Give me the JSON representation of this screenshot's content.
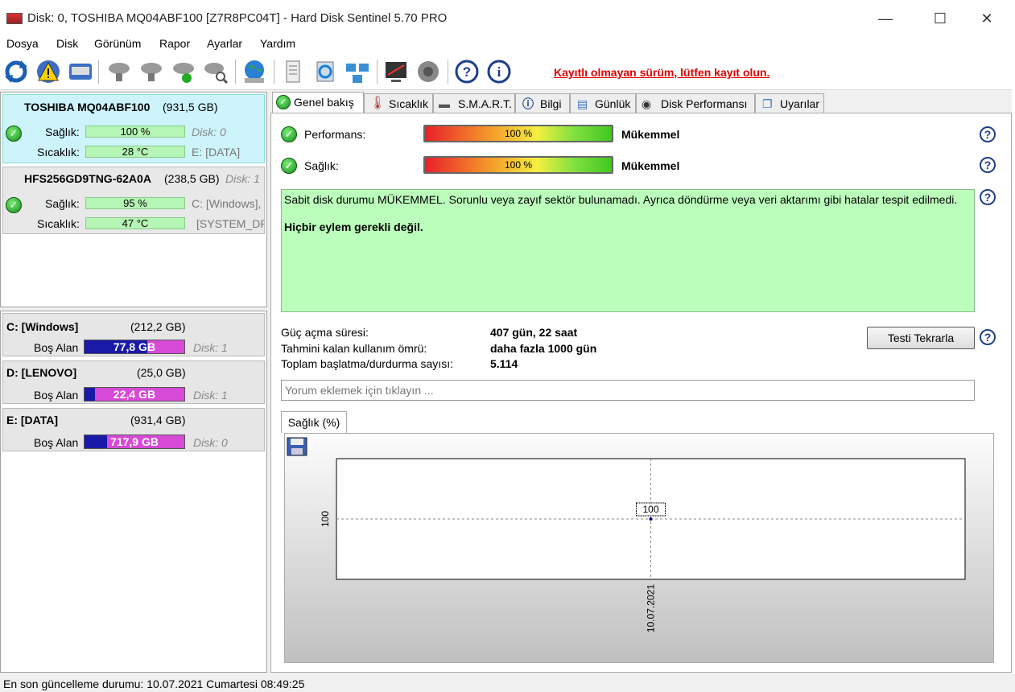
{
  "window": {
    "title": "Disk: 0, TOSHIBA MQ04ABF100 [Z7R8PC04T]  -  Hard Disk Sentinel 5.70 PRO",
    "minimize": "—",
    "maximize": "☐",
    "close": "✕"
  },
  "menu": [
    "Dosya",
    "Disk",
    "Görünüm",
    "Rapor",
    "Ayarlar",
    "Yardım"
  ],
  "toolbar": {
    "icons": [
      "refresh-icon",
      "warning-icon",
      "disk-icon",
      "disk-settings-icon",
      "disk-tools-icon",
      "disk-check-icon",
      "disk-search-icon",
      "globe-icon",
      "report-icon",
      "sync-icon",
      "network-icon",
      "monitor-icon",
      "speaker-icon",
      "help-icon",
      "info-icon"
    ],
    "register_link": "Kayıtlı olmayan sürüm, lütfen kayıt olun."
  },
  "disks": [
    {
      "name": "TOSHIBA MQ04ABF100",
      "size": "(931,5 GB)",
      "health_label": "Sağlık:",
      "health": "100 %",
      "disk_no": "Disk: 0",
      "temp_label": "Sıcaklık:",
      "temp": "28 °C",
      "volume": "E: [DATA]"
    },
    {
      "name": "HFS256GD9TNG-62A0A",
      "size": "(238,5 GB)",
      "disk_no": "Disk: 1",
      "health_label": "Sağlık:",
      "health": "95 %",
      "volume": "C: [Windows],",
      "temp_label": "Sıcaklık:",
      "temp": "47 °C",
      "volume2": "[SYSTEM_DRV"
    }
  ],
  "volumes": [
    {
      "name": "C: [Windows]",
      "size": "(212,2 GB)",
      "free_label": "Boş Alan",
      "free": "77,8 GB",
      "used_fraction": 0.633,
      "disk": "Disk: 1"
    },
    {
      "name": "D: [LENOVO]",
      "size": "(25,0 GB)",
      "free_label": "Boş Alan",
      "free": "22,4 GB",
      "used_fraction": 0.104,
      "disk": "Disk: 1"
    },
    {
      "name": "E: [DATA]",
      "size": "(931,4 GB)",
      "free_label": "Boş Alan",
      "free": "717,9 GB",
      "used_fraction": 0.229,
      "disk": "Disk: 0"
    }
  ],
  "tabs": [
    "Genel bakış",
    "Sıcaklık",
    "S.M.A.R.T.",
    "Bilgi",
    "Günlük",
    "Disk Performansı",
    "Uyarılar"
  ],
  "overview": {
    "performance_label": "Performans:",
    "performance_value": "100 %",
    "performance_text": "Mükemmel",
    "health_label": "Sağlık:",
    "health_value": "100 %",
    "health_text": "Mükemmel",
    "status_message": "Sabit disk durumu MÜKEMMEL. Sorunlu veya zayıf sektör bulunamadı. Ayrıca döndürme veya veri aktarımı gibi hatalar tespit edilmedi.",
    "action_message": "Hiçbir eylem gerekli değil.",
    "power_on_label": "Güç açma süresi:",
    "power_on_value": "407 gün, 22 saat",
    "remaining_label": "Tahmini kalan kullanım ömrü:",
    "remaining_value": "daha fazla 1000 gün",
    "startstop_label": "Toplam başlatma/durdurma sayısı:",
    "startstop_value": "5.114",
    "retest_button": "Testi Tekrarla",
    "comment_placeholder": "Yorum eklemek için tıklayın ...",
    "chart_tab": "Sağlık (%)"
  },
  "chart_data": {
    "type": "line",
    "x": [
      "10.07.2021"
    ],
    "series": [
      {
        "values": [
          100
        ]
      }
    ],
    "y_tick": "100",
    "data_label": "100",
    "grid": true
  },
  "statusbar": "En son güncelleme durumu: 10.07.2021 Cumartesi 08:49:25"
}
